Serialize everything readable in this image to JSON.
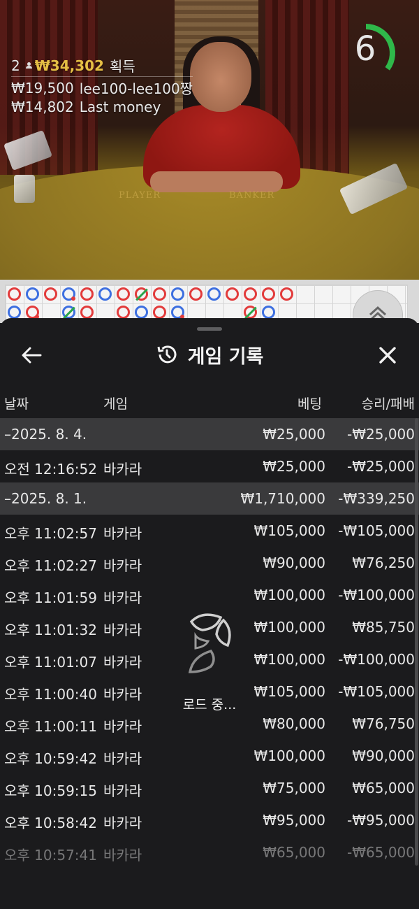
{
  "stream": {
    "table_player_label": "PLAYER",
    "table_banker_label": "BANKER",
    "players_count": "2",
    "win_amount": "₩34,302",
    "win_label": "획득",
    "lines": [
      {
        "amount": "₩19,500",
        "text": "lee100-lee100짱"
      },
      {
        "amount": "₩14,802",
        "text": "Last money"
      }
    ],
    "timer": "6",
    "timer_progress": 0.35,
    "timer_color": "#2fb84a"
  },
  "roadmap": {
    "colors": {
      "banker": "#e23b3b",
      "player": "#3d6fe0",
      "tie": "#2aa64a"
    }
  },
  "panel": {
    "title": "게임 기록",
    "columns": {
      "date": "날짜",
      "game": "게임",
      "bet": "베팅",
      "result": "승리/패배"
    },
    "loading_text": "로드 중...",
    "rows": [
      {
        "type": "group",
        "date": "–2025. 8. 4.",
        "bet": "₩25,000",
        "result": "-₩25,000"
      },
      {
        "type": "item",
        "time": "오전 12:16:52",
        "game": "바카라",
        "bet": "₩25,000",
        "result": "-₩25,000"
      },
      {
        "type": "group",
        "date": "–2025. 8. 1.",
        "bet": "₩1,710,000",
        "result": "-₩339,250"
      },
      {
        "type": "item",
        "time": "오후 11:02:57",
        "game": "바카라",
        "bet": "₩105,000",
        "result": "-₩105,000"
      },
      {
        "type": "item",
        "time": "오후 11:02:27",
        "game": "바카라",
        "bet": "₩90,000",
        "result": "₩76,250"
      },
      {
        "type": "item",
        "time": "오후 11:01:59",
        "game": "바카라",
        "bet": "₩100,000",
        "result": "-₩100,000"
      },
      {
        "type": "item",
        "time": "오후 11:01:32",
        "game": "바카라",
        "bet": "₩100,000",
        "result": "₩85,750"
      },
      {
        "type": "item",
        "time": "오후 11:01:07",
        "game": "바카라",
        "bet": "₩100,000",
        "result": "-₩100,000"
      },
      {
        "type": "item",
        "time": "오후 11:00:40",
        "game": "바카라",
        "bet": "₩105,000",
        "result": "-₩105,000"
      },
      {
        "type": "item",
        "time": "오후 11:00:11",
        "game": "바카라",
        "bet": "₩80,000",
        "result": "₩76,750"
      },
      {
        "type": "item",
        "time": "오후 10:59:42",
        "game": "바카라",
        "bet": "₩100,000",
        "result": "₩90,000"
      },
      {
        "type": "item",
        "time": "오후 10:59:15",
        "game": "바카라",
        "bet": "₩75,000",
        "result": "₩65,000"
      },
      {
        "type": "item",
        "time": "오후 10:58:42",
        "game": "바카라",
        "bet": "₩95,000",
        "result": "-₩95,000"
      },
      {
        "type": "item",
        "time": "오후 10:57:41",
        "game": "바카라",
        "bet": "₩65,000",
        "result": "-₩65,000"
      }
    ]
  }
}
